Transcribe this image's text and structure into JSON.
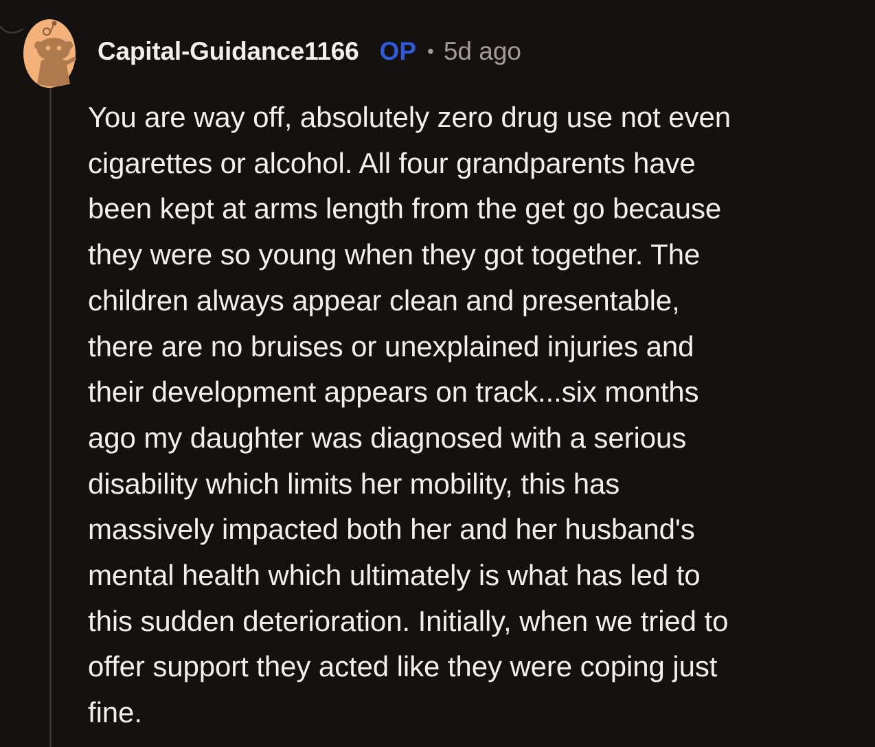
{
  "comment": {
    "username": "Capital-Guidance1166",
    "op_label": "OP",
    "separator": "•",
    "timestamp": "5d ago",
    "body": "You are way off, absolutely zero drug use not even\ncigarettes or alcohol. All four grandparents have\nbeen kept at arms length from the get go because\nthey were so young when they got together. The\nchildren always appear clean and presentable,\nthere are no bruises or unexplained injuries and\ntheir development appears on track...six months\nago my daughter was diagnosed with a serious\ndisability which limits her mobility, this has\nmassively impacted both her and her husband's\nmental health which ultimately is what has led to\nthis sudden deterioration. Initially, when we tried to\noffer support they acted like they were coping just\nfine."
  },
  "icons": {
    "avatar": "snoo-avatar-icon"
  },
  "colors": {
    "background": "#141110",
    "text": "#f2efec",
    "muted": "#a29d99",
    "op_accent": "#2f5bd9",
    "avatar_bg": "#f2b27a",
    "avatar_figure": "#b07a4f",
    "thread_line": "#3a3634"
  }
}
